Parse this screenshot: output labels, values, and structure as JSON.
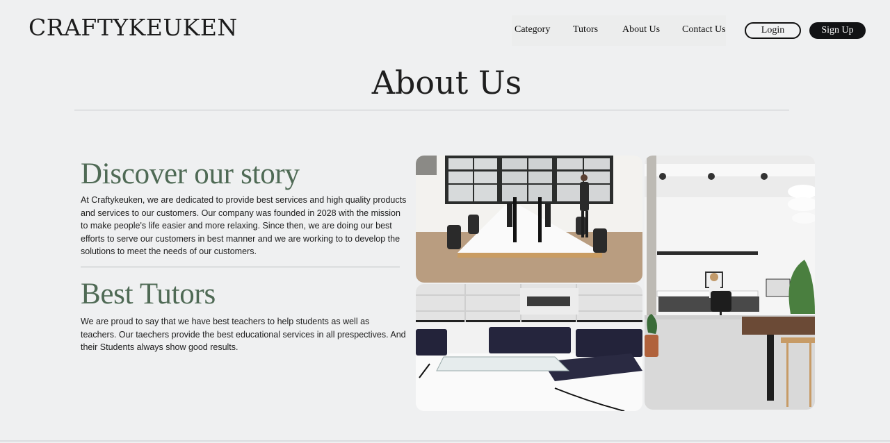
{
  "header": {
    "logo": "CRAFTYKEUKEN",
    "nav": [
      "Category",
      "Tutors",
      "About Us",
      "Contact Us"
    ],
    "login_label": "Login",
    "signup_label": "Sign Up"
  },
  "page": {
    "title": "About Us"
  },
  "story": {
    "heading": "Discover our story",
    "body": "At Craftykeuken, we are dedicated to provide best services and high quality products and services to our customers. Our company was founded in 2028 with the mission to make people's life easier and more relaxing. Since then, we are doing our best efforts to serve our customers in best manner and we are working to to develop the solutions to meet the needs of our customers."
  },
  "tutors": {
    "heading": "Best Tutors",
    "body": "We are proud to say that we have best teachers to help students as well as teachers. Our taechers provide the best educational services in all prespectives. And their Students always show good results."
  },
  "images": {
    "office": "office-workspace-photo",
    "lounge": "lounge-chairs-photo",
    "studio": "studio-workspace-photo"
  },
  "colors": {
    "background": "#eff0f1",
    "heading_green": "#4f6a55",
    "signup_bg": "#121315"
  }
}
